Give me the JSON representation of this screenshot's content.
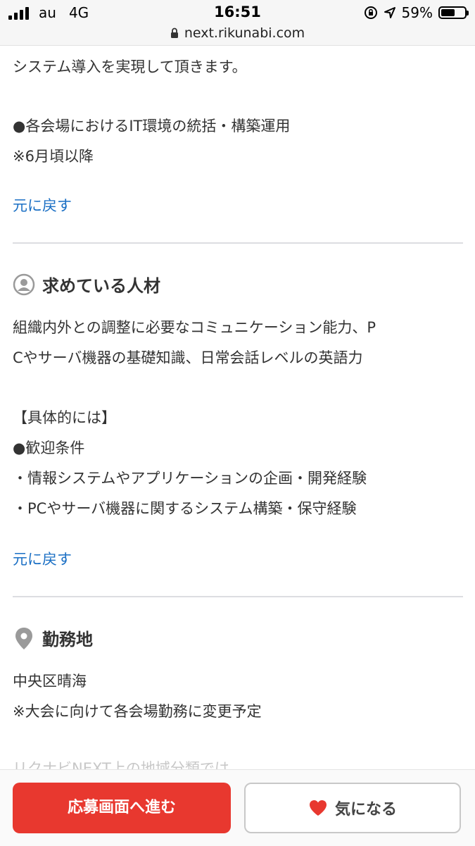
{
  "status_bar": {
    "carrier": "au",
    "network": "4G",
    "time": "16:51",
    "battery": "59%",
    "battery_level": 0.59,
    "url": "next.rikunabi.com"
  },
  "job_content": {
    "lines": [
      "システム導入を実現して頂きます。"
    ],
    "bullet": "●各会場におけるIT環境の統括・構築運用",
    "note": "※6月頃以降",
    "back_link": "元に戻す"
  },
  "talent_section": {
    "title": "求めている人材",
    "icon": "person-icon",
    "desc_1": "組織内外との調整に必要なコミュニケーション能力、P",
    "desc_2": "Cやサーバ機器の基礎知識、日常会話レベルの英語力",
    "specific": "【具体的には】",
    "welcome": "●歓迎条件",
    "item_1": "・情報システムやアプリケーションの企画・開発経験",
    "item_2": "・PCやサーバ機器に関するシステム構築・保守経験",
    "back_link": "元に戻す"
  },
  "location_section": {
    "title": "勤務地",
    "icon": "location-pin-icon",
    "place": "中央区晴海",
    "note": "※大会に向けて各会場勤務に変更予定",
    "partial": "リクナビNEXT上の地域分類では"
  },
  "bottom_bar": {
    "apply_label": "応募画面へ進む",
    "favorite_label": "気になる"
  },
  "colors": {
    "apply": "#e8382f",
    "link": "#1a6fc4",
    "heart": "#e8382f"
  }
}
